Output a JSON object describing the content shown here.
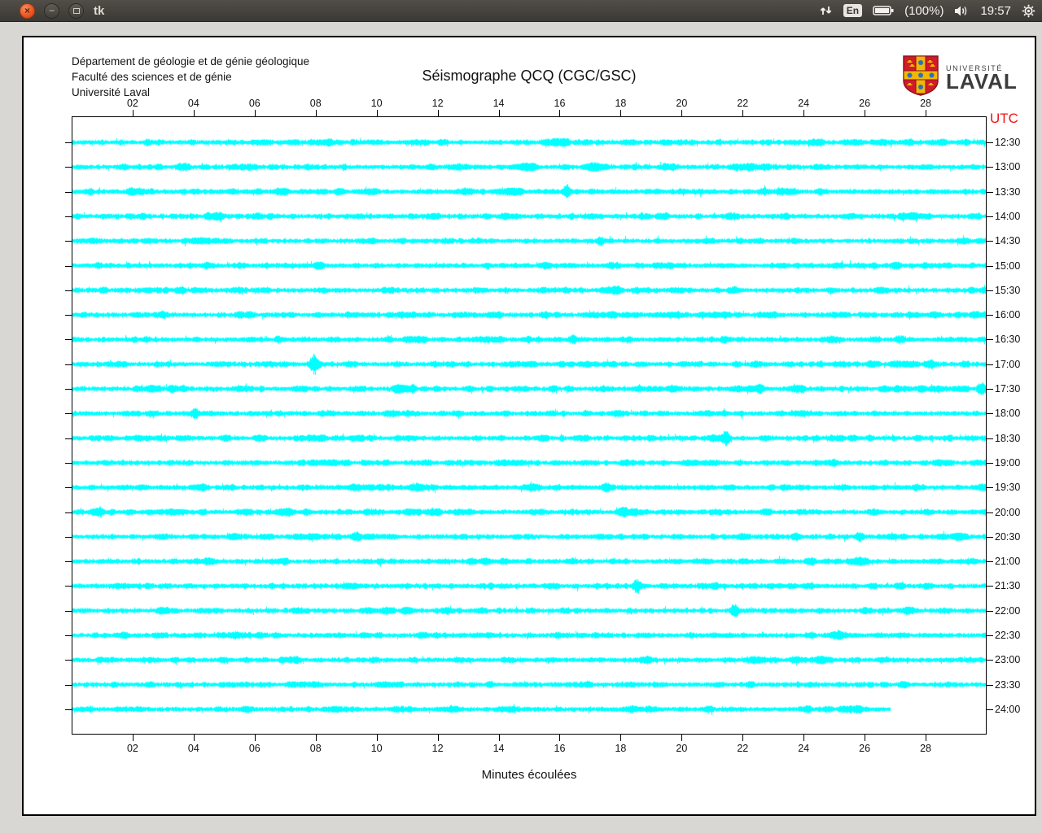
{
  "taskbar": {
    "title": "tk",
    "window_buttons": {
      "close": "×",
      "minimize": "−",
      "maximize": ""
    },
    "tray": {
      "keyboard_layout": "En",
      "battery_percent": "(100%)",
      "time": "19:57",
      "icons": [
        "updown-arrows-icon",
        "battery-icon",
        "volume-icon",
        "gear-icon"
      ]
    }
  },
  "header": {
    "org_lines": "Département de géologie et de génie géologique\nFaculté des sciences et de génie\nUniversité Laval",
    "logo": {
      "line1": "UNIVERSITÉ",
      "line2": "LAVAL"
    }
  },
  "chart_data": {
    "type": "line",
    "subtype": "helicorder-seismogram",
    "title": "Séismographe QCQ (CGC/GSC)",
    "xlabel": "Minutes écoulées",
    "x_range": [
      0,
      30
    ],
    "x_tick_minutes": [
      2,
      4,
      6,
      8,
      10,
      12,
      14,
      16,
      18,
      20,
      22,
      24,
      26,
      28
    ],
    "x_tick_labels": [
      "02",
      "04",
      "06",
      "08",
      "10",
      "12",
      "14",
      "16",
      "18",
      "20",
      "22",
      "24",
      "26",
      "28"
    ],
    "right_axis_label": "UTC",
    "right_axis_label_color": "#f01414",
    "trace_color": "#00ffff",
    "grid": false,
    "rows": [
      {
        "utc": "12:30",
        "start_minute": 0,
        "end_minute": 30
      },
      {
        "utc": "13:00",
        "start_minute": 0,
        "end_minute": 30
      },
      {
        "utc": "13:30",
        "start_minute": 0,
        "end_minute": 30
      },
      {
        "utc": "14:00",
        "start_minute": 0,
        "end_minute": 30
      },
      {
        "utc": "14:30",
        "start_minute": 0,
        "end_minute": 30
      },
      {
        "utc": "15:00",
        "start_minute": 0,
        "end_minute": 30
      },
      {
        "utc": "15:30",
        "start_minute": 0,
        "end_minute": 30
      },
      {
        "utc": "16:00",
        "start_minute": 0,
        "end_minute": 30
      },
      {
        "utc": "16:30",
        "start_minute": 0,
        "end_minute": 30
      },
      {
        "utc": "17:00",
        "start_minute": 0,
        "end_minute": 30
      },
      {
        "utc": "17:30",
        "start_minute": 0,
        "end_minute": 30
      },
      {
        "utc": "18:00",
        "start_minute": 0,
        "end_minute": 30
      },
      {
        "utc": "18:30",
        "start_minute": 0,
        "end_minute": 30
      },
      {
        "utc": "19:00",
        "start_minute": 0,
        "end_minute": 30
      },
      {
        "utc": "19:30",
        "start_minute": 0,
        "end_minute": 30
      },
      {
        "utc": "20:00",
        "start_minute": 0,
        "end_minute": 30
      },
      {
        "utc": "20:30",
        "start_minute": 0,
        "end_minute": 30
      },
      {
        "utc": "21:00",
        "start_minute": 0,
        "end_minute": 30
      },
      {
        "utc": "21:30",
        "start_minute": 0,
        "end_minute": 30
      },
      {
        "utc": "22:00",
        "start_minute": 0,
        "end_minute": 30
      },
      {
        "utc": "22:30",
        "start_minute": 0,
        "end_minute": 30
      },
      {
        "utc": "23:00",
        "start_minute": 0,
        "end_minute": 30
      },
      {
        "utc": "23:30",
        "start_minute": 0,
        "end_minute": 30
      },
      {
        "utc": "24:00",
        "start_minute": 0,
        "end_minute": 26.8
      }
    ],
    "events": [
      {
        "utc": "13:30",
        "minute": 16.2,
        "size": "medium"
      },
      {
        "utc": "14:30",
        "minute": 17.3,
        "size": "small"
      },
      {
        "utc": "16:30",
        "minute": 16.4,
        "size": "small"
      },
      {
        "utc": "16:30",
        "minute": 27.1,
        "size": "small"
      },
      {
        "utc": "17:00",
        "minute": 7.9,
        "size": "large"
      },
      {
        "utc": "17:30",
        "minute": 29.8,
        "size": "medium"
      },
      {
        "utc": "18:00",
        "minute": 4.0,
        "size": "small"
      },
      {
        "utc": "18:30",
        "minute": 21.4,
        "size": "medium"
      },
      {
        "utc": "19:30",
        "minute": 17.5,
        "size": "small"
      },
      {
        "utc": "20:00",
        "minute": 0.9,
        "size": "small"
      },
      {
        "utc": "20:30",
        "minute": 9.3,
        "size": "small"
      },
      {
        "utc": "20:30",
        "minute": 25.8,
        "size": "small"
      },
      {
        "utc": "21:30",
        "minute": 18.5,
        "size": "medium"
      },
      {
        "utc": "22:00",
        "minute": 21.7,
        "size": "medium"
      }
    ]
  }
}
